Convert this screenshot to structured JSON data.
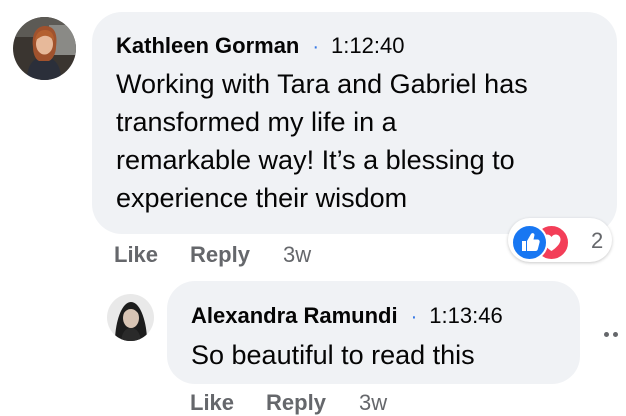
{
  "comments": [
    {
      "author": "Kathleen Gorman",
      "separator": "·",
      "time": "1:12:40",
      "lines": [
        "Working with Tara and Gabriel has",
        "transformed my life in a",
        "remarkable way! It’s a blessing to",
        "experience their wisdom"
      ],
      "reactions": {
        "icons": [
          "thumbs-up-icon",
          "heart-icon"
        ],
        "count": "2",
        "like_color": "#1877f2",
        "love_color": "#f33e58"
      },
      "actions": {
        "like": "Like",
        "reply": "Reply",
        "age": "3w"
      }
    },
    {
      "author": "Alexandra Ramundi",
      "separator": "·",
      "time": "1:13:46",
      "lines": [
        "So beautiful to read this"
      ],
      "actions": {
        "like": "Like",
        "reply": "Reply",
        "age": "3w"
      }
    }
  ],
  "colors": {
    "bubble": "#f0f2f5",
    "text": "#050505",
    "secondary": "#65676b",
    "separator_dot": "#3578e5"
  }
}
